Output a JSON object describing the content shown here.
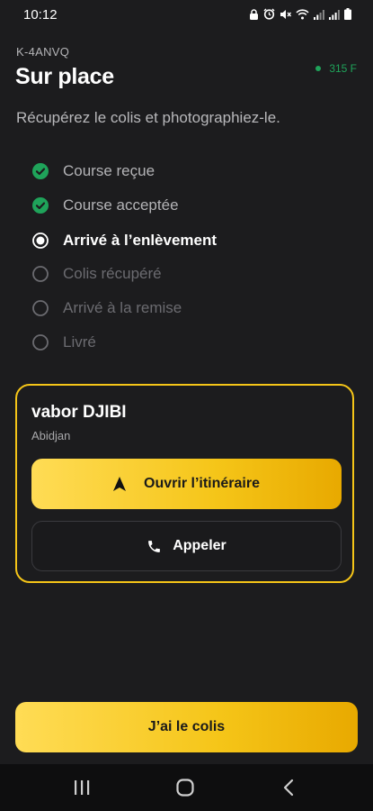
{
  "status_bar": {
    "time": "10:12"
  },
  "header": {
    "order_id": "K-4ANVQ",
    "title": "Sur place",
    "earning": "315 F",
    "instruction": "Récupérez le colis et photographiez-le."
  },
  "steps": [
    {
      "label": "Course reçue",
      "state": "done"
    },
    {
      "label": "Course acceptée",
      "state": "done"
    },
    {
      "label": "Arrivé à l’enlèvement",
      "state": "current"
    },
    {
      "label": "Colis récupéré",
      "state": "pending"
    },
    {
      "label": "Arrivé à la remise",
      "state": "pending"
    },
    {
      "label": "Livré",
      "state": "pending"
    }
  ],
  "customer_card": {
    "name": "vabor DJIBI",
    "city": "Abidjan",
    "route_button": "Ouvrir l’itinéraire",
    "call_button": "Appeler"
  },
  "primary_action": {
    "label": "J’ai le colis"
  },
  "colors": {
    "background": "#1c1c1e",
    "accent": "#f5c518",
    "success": "#1fa35a",
    "pending": "#6b6b70"
  }
}
